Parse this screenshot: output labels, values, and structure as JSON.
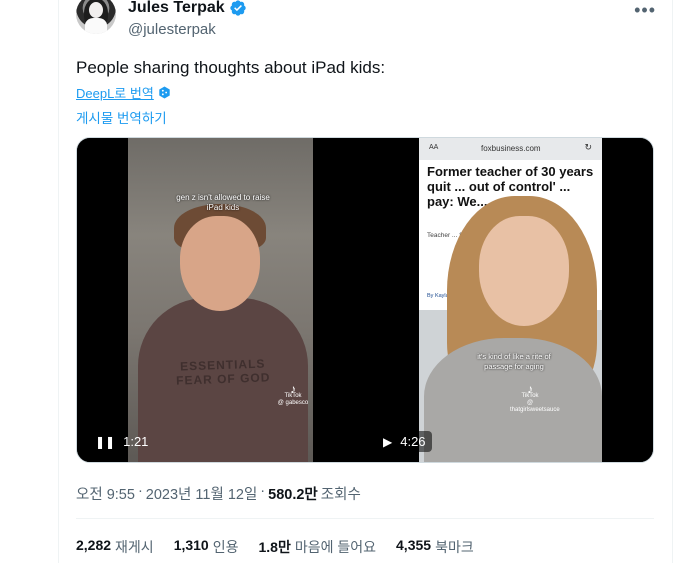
{
  "author": {
    "name": "Jules Terpak",
    "handle": "@julesterpak"
  },
  "more_icon": "more-icon",
  "tweet": {
    "text": "People sharing thoughts about iPad kids:",
    "translate_deepl": "DeepL로 번역",
    "translate_post": "게시물 번역하기"
  },
  "media": {
    "video1": {
      "caption": "gen z isn't allowed to raise iPad kids",
      "hoodie_text": "ESSENTIALS FEAR OF GOD",
      "tiktok_label": "TikTok",
      "tiktok_user": "@ gabesco",
      "control_icon": "pause-icon",
      "duration": "1:21"
    },
    "video2": {
      "address_aa": "AA",
      "url": "foxbusiness.com",
      "headline": "Former teacher of 30 years quit ... out of control' ... pay: We...",
      "subline": "Teacher ... Sawyer s...",
      "author": "By Kayla Bail...",
      "caption": "it's kind of like a rite of passage for aging",
      "tiktok_label": "TikTok",
      "tiktok_user": "@ thatgirlsweetsauce",
      "control_icon": "play-icon",
      "duration": "4:26"
    }
  },
  "meta": {
    "time": "오전 9:55",
    "separator": "·",
    "date": "2023년 11월 12일",
    "views_count": "580.2만",
    "views_label": "조회수"
  },
  "stats": [
    {
      "num": "2,282",
      "label": "재게시"
    },
    {
      "num": "1,310",
      "label": "인용"
    },
    {
      "num": "1.8만",
      "label": "마음에 들어요"
    },
    {
      "num": "4,355",
      "label": "북마크"
    }
  ],
  "colors": {
    "accent": "#1d9bf0",
    "secondary_text": "#536471",
    "primary_text": "#0f1419"
  }
}
